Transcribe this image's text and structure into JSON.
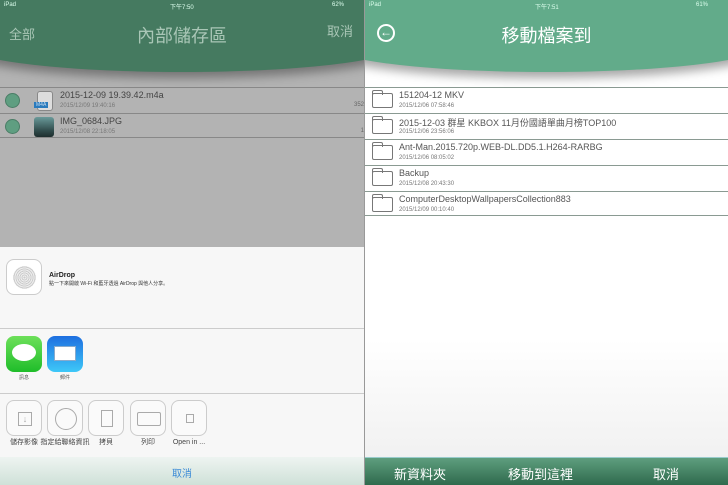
{
  "left": {
    "status": {
      "device": "iPad",
      "time": "下午7:50",
      "battery": "62%"
    },
    "header": {
      "title": "內部儲存區",
      "left_button": "全部",
      "right_button": "取消"
    },
    "files": [
      {
        "name": "2015-12-09 19.39.42.m4a",
        "date": "2015/12/09 19:40:16",
        "size": "352",
        "badge": "M4A"
      },
      {
        "name": "IMG_0684.JPG",
        "date": "2015/12/08 22:18:05",
        "size": "1"
      }
    ],
    "share": {
      "airdrop": {
        "title": "AirDrop",
        "desc": "點一下來開啟 Wi-Fi 和藍牙透過 AirDrop 與他人分享。"
      },
      "apps": [
        {
          "label": "訊息",
          "icon": "messages-icon"
        },
        {
          "label": "郵件",
          "icon": "mail-icon"
        }
      ],
      "actions": [
        {
          "label": "儲存影像"
        },
        {
          "label": "指定給聯絡資訊"
        },
        {
          "label": "拷貝"
        },
        {
          "label": "列印"
        },
        {
          "label": "Open in ..."
        }
      ],
      "cancel": "取消"
    }
  },
  "right": {
    "status": {
      "device": "iPad",
      "time": "下午7:51",
      "battery": "61%"
    },
    "header": {
      "title": "移動檔案到"
    },
    "folders": [
      {
        "name": "151204-12 MKV",
        "date": "2015/12/06 07:58:46"
      },
      {
        "name": "2015-12-03 群星 KKBOX 11月份國語單曲月榜TOP100",
        "date": "2015/12/06 23:56:06"
      },
      {
        "name": "Ant-Man.2015.720p.WEB-DL.DD5.1.H264-RARBG",
        "date": "2015/12/06 08:05:02"
      },
      {
        "name": "Backup",
        "date": "2015/12/08 20:43:30"
      },
      {
        "name": "ComputerDesktopWallpapersCollection883",
        "date": "2015/12/09 00:10:40"
      }
    ],
    "toolbar": {
      "new_folder": "新資料夾",
      "move_here": "移動到這裡",
      "cancel": "取消"
    }
  },
  "colors": {
    "header_green": "#62ab8a",
    "toolbar_green": "#2f6a4d",
    "link_blue": "#3a8ad6"
  }
}
